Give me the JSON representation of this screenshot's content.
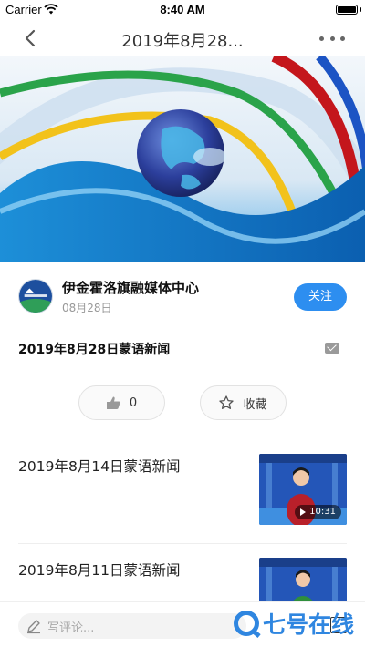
{
  "status_bar": {
    "carrier": "Carrier",
    "time": "8:40 AM"
  },
  "nav": {
    "title": "2019年8月28..."
  },
  "author": {
    "name": "伊金霍洛旗融媒体中心",
    "date": "08月28日",
    "follow_label": "关注"
  },
  "article": {
    "title": "2019年8月28日蒙语新闻"
  },
  "actions": {
    "like_count": "0",
    "collect_label": "收藏"
  },
  "news_list": [
    {
      "title": "2019年8月14日蒙语新闻",
      "duration": "10:31"
    },
    {
      "title": "2019年8月11日蒙语新闻"
    }
  ],
  "comment": {
    "placeholder": "写评论..."
  },
  "watermark": {
    "text": "七号在线"
  },
  "colors": {
    "accent": "#2d8ef0",
    "watermark": "#2f86e0"
  }
}
